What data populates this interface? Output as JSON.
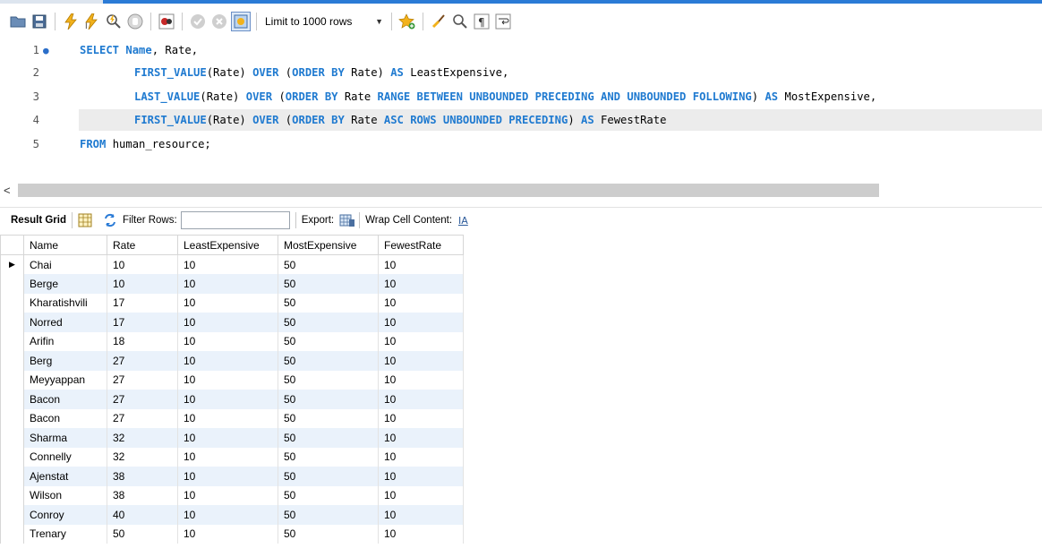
{
  "toolbar": {
    "limit_label": "Limit to 1000 rows"
  },
  "editor": {
    "lines": [
      {
        "num": "1"
      },
      {
        "num": "2"
      },
      {
        "num": "3"
      },
      {
        "num": "4"
      },
      {
        "num": "5"
      }
    ],
    "line1": {
      "k1": "SELECT",
      "k2": "Name",
      "t1": ", Rate,"
    },
    "line2": {
      "k1": "FIRST_VALUE",
      "t1": "(Rate) ",
      "k2": "OVER",
      "t2": " (",
      "k3": "ORDER BY",
      "t3": " Rate) ",
      "k4": "AS",
      "t4": " LeastExpensive,"
    },
    "line3": {
      "k1": "LAST_VALUE",
      "t1": "(Rate) ",
      "k2": "OVER",
      "t2": " (",
      "k3": "ORDER BY",
      "t3": " Rate ",
      "k4": "RANGE BETWEEN UNBOUNDED PRECEDING AND UNBOUNDED FOLLOWING",
      "t4": ") ",
      "k5": "AS",
      "t5": " MostExpensive,"
    },
    "line4": {
      "k1": "FIRST_VALUE",
      "t1": "(Rate) ",
      "k2": "OVER",
      "t2": " (",
      "k3": "ORDER BY",
      "t3": " Rate ",
      "k4": "ASC ROWS UNBOUNDED PRECEDING",
      "t4": ") ",
      "k5": "AS",
      "t5": " FewestRate"
    },
    "line5": {
      "k1": "FROM",
      "t1": " human_resource;"
    }
  },
  "result_bar": {
    "tab_label": "Result Grid",
    "filter_label": "Filter Rows:",
    "filter_value": "",
    "export_label": "Export:",
    "wrap_label": "Wrap Cell Content:"
  },
  "grid": {
    "columns": [
      "Name",
      "Rate",
      "LeastExpensive",
      "MostExpensive",
      "FewestRate"
    ],
    "rows": [
      [
        "Chai",
        "10",
        "10",
        "50",
        "10"
      ],
      [
        "Berge",
        "10",
        "10",
        "50",
        "10"
      ],
      [
        "Kharatishvili",
        "17",
        "10",
        "50",
        "10"
      ],
      [
        "Norred",
        "17",
        "10",
        "50",
        "10"
      ],
      [
        "Arifin",
        "18",
        "10",
        "50",
        "10"
      ],
      [
        "Berg",
        "27",
        "10",
        "50",
        "10"
      ],
      [
        "Meyyappan",
        "27",
        "10",
        "50",
        "10"
      ],
      [
        "Bacon",
        "27",
        "10",
        "50",
        "10"
      ],
      [
        "Bacon",
        "27",
        "10",
        "50",
        "10"
      ],
      [
        "Sharma",
        "32",
        "10",
        "50",
        "10"
      ],
      [
        "Connelly",
        "32",
        "10",
        "50",
        "10"
      ],
      [
        "Ajenstat",
        "38",
        "10",
        "50",
        "10"
      ],
      [
        "Wilson",
        "38",
        "10",
        "50",
        "10"
      ],
      [
        "Conroy",
        "40",
        "10",
        "50",
        "10"
      ],
      [
        "Trenary",
        "50",
        "10",
        "50",
        "10"
      ]
    ]
  },
  "colors": {
    "keyword": "#1f7ad0",
    "accent": "#2b7bd6",
    "row_alt": "#eaf2fb"
  }
}
